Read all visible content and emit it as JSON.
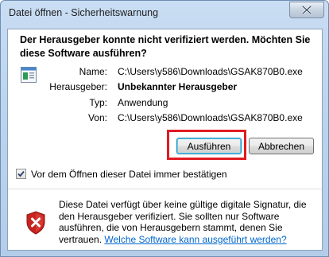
{
  "window": {
    "title": "Datei öffnen - Sicherheitswarnung"
  },
  "heading": "Der Herausgeber konnte nicht verifiziert werden. Möchten Sie diese Software ausführen?",
  "details": {
    "name_label": "Name:",
    "name_value": "C:\\Users\\y586\\Downloads\\GSAK870B0.exe",
    "publisher_label": "Herausgeber:",
    "publisher_value": "Unbekannter Herausgeber",
    "type_label": "Typ:",
    "type_value": "Anwendung",
    "from_label": "Von:",
    "from_value": "C:\\Users\\y586\\Downloads\\GSAK870B0.exe"
  },
  "buttons": {
    "run_label": "Ausführen",
    "cancel_label": "Abbrechen"
  },
  "checkbox": {
    "label": "Vor dem Öffnen dieser Datei immer bestätigen",
    "checked": true
  },
  "warning": {
    "text": "Diese Datei verfügt über keine gültige digitale Signatur, die den Herausgeber verifiziert. Sie sollten nur Software ausführen, die von Herausgebern stammt, denen Sie vertrauen.",
    "link_text": "Welche Software kann ausgeführt werden?"
  },
  "colors": {
    "highlight": "#e21b22",
    "link": "#0066cc",
    "shield_red": "#c8231f"
  },
  "icons": {
    "file": "application-file-icon",
    "shield": "security-shield-warning-icon",
    "close": "close-icon",
    "check": "checkmark-icon"
  }
}
